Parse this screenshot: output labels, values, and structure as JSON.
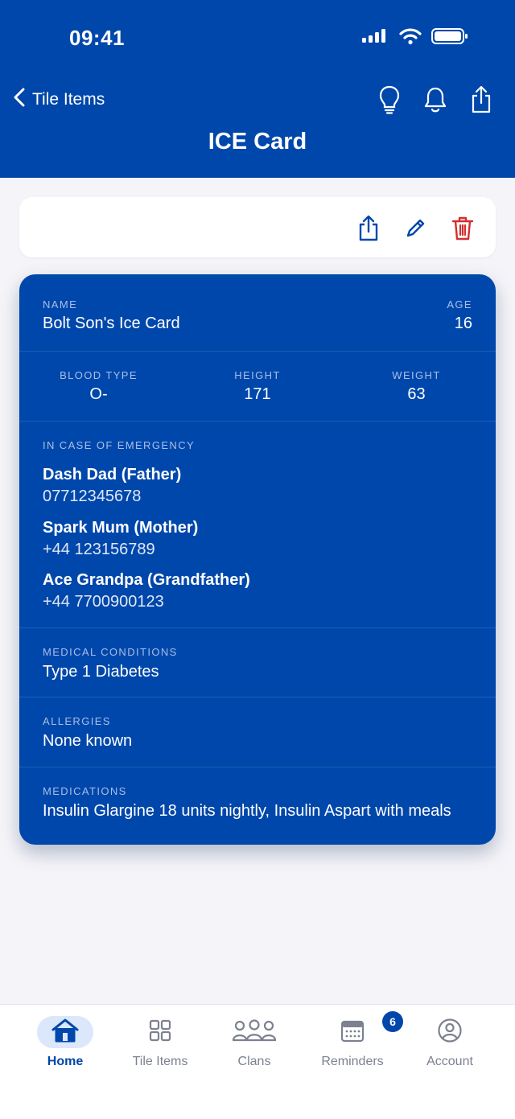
{
  "status_bar": {
    "time": "09:41"
  },
  "nav": {
    "back_label": "Tile Items",
    "title": "ICE Card"
  },
  "card": {
    "name_label": "NAME",
    "name": "Bolt Son's Ice Card",
    "age_label": "AGE",
    "age": "16",
    "blood_type_label": "BLOOD TYPE",
    "blood_type": "O-",
    "height_label": "HEIGHT",
    "height": "171",
    "weight_label": "WEIGHT",
    "weight": "63",
    "emergency_label": "IN CASE OF EMERGENCY",
    "contacts": [
      {
        "name": "Dash Dad (Father)",
        "phone": "07712345678"
      },
      {
        "name": "Spark Mum (Mother)",
        "phone": "+44 123156789"
      },
      {
        "name": "Ace Grandpa (Grandfather)",
        "phone": "+44 7700900123"
      }
    ],
    "conditions_label": "MEDICAL CONDITIONS",
    "conditions": "Type 1 Diabetes",
    "allergies_label": "ALLERGIES",
    "allergies": "None known",
    "medications_label": "MEDICATIONS",
    "medications": "Insulin Glargine 18 units nightly, Insulin Aspart with meals"
  },
  "tabs": [
    {
      "label": "Home",
      "icon": "home-icon",
      "active": true
    },
    {
      "label": "Tile Items",
      "icon": "grid-icon"
    },
    {
      "label": "Clans",
      "icon": "people-icon"
    },
    {
      "label": "Reminders",
      "icon": "calendar-icon",
      "badge": "6"
    },
    {
      "label": "Account",
      "icon": "account-icon"
    }
  ],
  "colors": {
    "brand": "#0047ab",
    "danger": "#d32f2f",
    "muted": "#7b8190"
  }
}
